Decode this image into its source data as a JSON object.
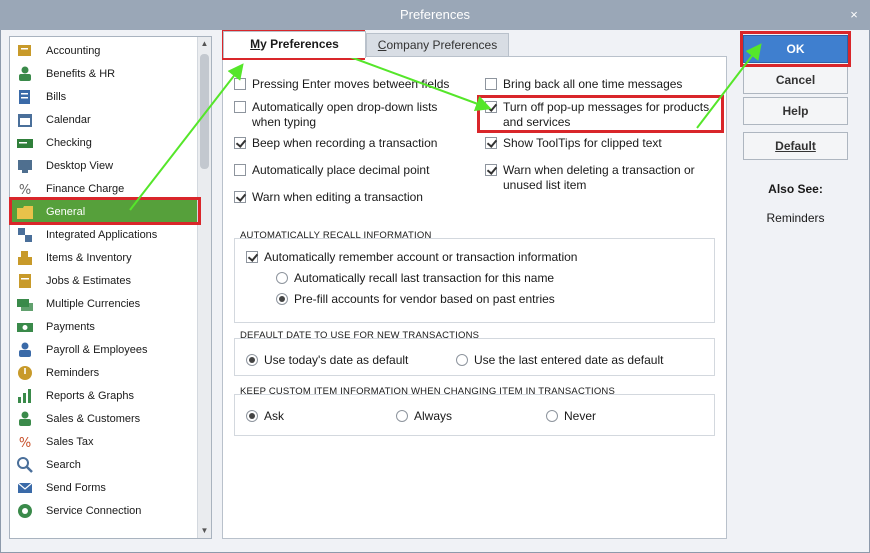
{
  "window": {
    "title": "Preferences",
    "close_glyph": "×"
  },
  "categories": [
    {
      "label": "Accounting",
      "icon": "accounting-icon",
      "color": "#c89a2a"
    },
    {
      "label": "Benefits & HR",
      "icon": "benefits-icon",
      "color": "#3a8a4a"
    },
    {
      "label": "Bills",
      "icon": "bills-icon",
      "color": "#3a6aa8"
    },
    {
      "label": "Calendar",
      "icon": "calendar-icon",
      "color": "#4a6f9a"
    },
    {
      "label": "Checking",
      "icon": "checking-icon",
      "color": "#2f7f3a"
    },
    {
      "label": "Desktop View",
      "icon": "desktop-view-icon",
      "color": "#4f6f8f"
    },
    {
      "label": "Finance Charge",
      "icon": "finance-charge-icon",
      "color": "#666666"
    },
    {
      "label": "General",
      "icon": "general-icon",
      "color": "#e8c24a"
    },
    {
      "label": "Integrated Applications",
      "icon": "integrated-apps-icon",
      "color": "#4a6f9a"
    },
    {
      "label": "Items & Inventory",
      "icon": "items-inventory-icon",
      "color": "#c89a2a"
    },
    {
      "label": "Jobs & Estimates",
      "icon": "jobs-estimates-icon",
      "color": "#c89a2a"
    },
    {
      "label": "Multiple Currencies",
      "icon": "multiple-currencies-icon",
      "color": "#3a8a4a"
    },
    {
      "label": "Payments",
      "icon": "payments-icon",
      "color": "#3a8a4a"
    },
    {
      "label": "Payroll & Employees",
      "icon": "payroll-icon",
      "color": "#3a6aa8"
    },
    {
      "label": "Reminders",
      "icon": "reminders-icon",
      "color": "#c89a2a"
    },
    {
      "label": "Reports & Graphs",
      "icon": "reports-graphs-icon",
      "color": "#3a8a4a"
    },
    {
      "label": "Sales & Customers",
      "icon": "sales-customers-icon",
      "color": "#3a8a4a"
    },
    {
      "label": "Sales Tax",
      "icon": "sales-tax-icon",
      "color": "#c8502a"
    },
    {
      "label": "Search",
      "icon": "search-icon",
      "color": "#4a6f9a"
    },
    {
      "label": "Send Forms",
      "icon": "send-forms-icon",
      "color": "#3a6aa8"
    },
    {
      "label": "Service Connection",
      "icon": "service-connection-icon",
      "color": "#3a8a4a"
    }
  ],
  "selected_category": "General",
  "tabs": {
    "my": {
      "accel": "M",
      "rest": "y Preferences"
    },
    "company": {
      "accel": "C",
      "rest": "ompany Preferences"
    }
  },
  "options_left": [
    {
      "label": "Pressing Enter moves between fields",
      "checked": false
    },
    {
      "label": "Automatically open drop-down lists when typing",
      "checked": false
    },
    {
      "label": "Beep when recording a transaction",
      "checked": true
    },
    {
      "label": "Automatically place decimal point",
      "checked": false
    },
    {
      "label": "Warn when editing a transaction",
      "checked": true
    }
  ],
  "options_right": [
    {
      "label": "Bring back all one time messages",
      "checked": false
    },
    {
      "label": "Turn off pop-up messages for products and services",
      "checked": true
    },
    {
      "label": "Show ToolTips for clipped text",
      "checked": true
    },
    {
      "label": "Warn when deleting a transaction or unused list item",
      "checked": true
    }
  ],
  "recall": {
    "title": "AUTOMATICALLY RECALL INFORMATION",
    "main": {
      "label": "Automatically remember account or transaction information",
      "checked": true
    },
    "choices": [
      {
        "label": "Automatically recall last transaction for this name",
        "checked": false
      },
      {
        "label": "Pre-fill accounts for vendor based on past entries",
        "checked": true
      }
    ]
  },
  "default_date": {
    "title": "DEFAULT DATE TO USE FOR NEW TRANSACTIONS",
    "choices": [
      {
        "label": "Use today's date as default",
        "checked": true
      },
      {
        "label": "Use the last entered date as default",
        "checked": false
      }
    ]
  },
  "custom_item": {
    "title": "KEEP CUSTOM ITEM INFORMATION WHEN CHANGING ITEM IN TRANSACTIONS",
    "choices": [
      {
        "label": "Ask",
        "checked": true
      },
      {
        "label": "Always",
        "checked": false
      },
      {
        "label": "Never",
        "checked": false
      }
    ]
  },
  "buttons": {
    "ok": "OK",
    "cancel": "Cancel",
    "help": "Help",
    "default": "Default"
  },
  "also_see": {
    "title": "Also See:",
    "link": "Reminders"
  },
  "colors": {
    "highlight_red": "#d9262a",
    "arrow_green": "#55e62a",
    "selected_green": "#56a03b",
    "ok_blue": "#3f7fcf"
  }
}
